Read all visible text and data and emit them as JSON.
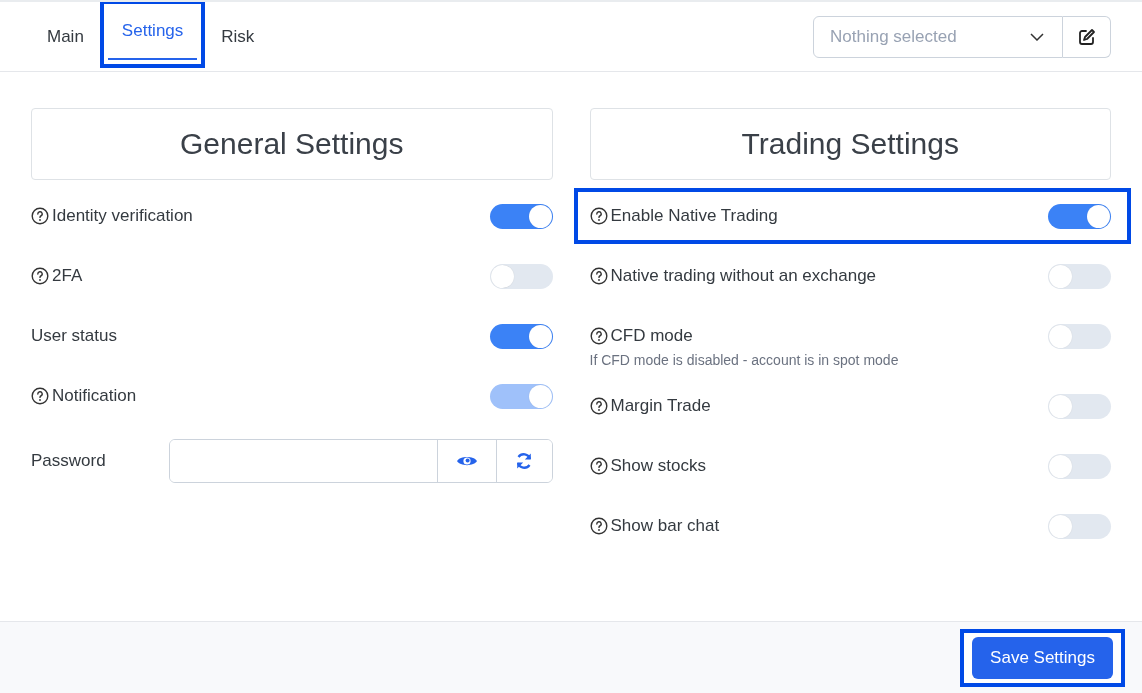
{
  "tabs": [
    {
      "label": "Main",
      "selected": false,
      "highlighted": false
    },
    {
      "label": "Settings",
      "selected": true,
      "highlighted": true
    },
    {
      "label": "Risk",
      "selected": false,
      "highlighted": false
    }
  ],
  "selector": {
    "placeholder": "Nothing selected"
  },
  "sections": [
    {
      "title": "General Settings",
      "items": [
        {
          "kind": "toggle",
          "label": "Identity verification",
          "help": true,
          "on": true,
          "disabled": false,
          "highlighted": false
        },
        {
          "kind": "toggle",
          "label": "2FA",
          "help": true,
          "on": false,
          "disabled": false,
          "highlighted": false
        },
        {
          "kind": "toggle",
          "label": "User status",
          "help": false,
          "on": true,
          "disabled": false,
          "highlighted": false
        },
        {
          "kind": "toggle",
          "label": "Notification",
          "help": true,
          "on": true,
          "disabled": true,
          "highlighted": false
        },
        {
          "kind": "password",
          "label": "Password"
        }
      ]
    },
    {
      "title": "Trading Settings",
      "items": [
        {
          "kind": "toggle",
          "label": "Enable Native Trading",
          "help": true,
          "on": true,
          "disabled": false,
          "highlighted": true
        },
        {
          "kind": "toggle",
          "label": "Native trading without an exchange",
          "help": true,
          "on": false,
          "disabled": false,
          "highlighted": false
        },
        {
          "kind": "toggle",
          "label": "CFD mode",
          "help": true,
          "on": false,
          "disabled": false,
          "highlighted": false
        },
        {
          "kind": "note",
          "text": "If CFD mode is disabled - account is in spot mode"
        },
        {
          "kind": "toggle",
          "label": "Margin Trade",
          "help": true,
          "on": false,
          "disabled": false,
          "highlighted": false
        },
        {
          "kind": "toggle",
          "label": "Show stocks",
          "help": true,
          "on": false,
          "disabled": false,
          "highlighted": false
        },
        {
          "kind": "toggle",
          "label": "Show bar chat",
          "help": true,
          "on": false,
          "disabled": false,
          "highlighted": false
        }
      ]
    }
  ],
  "save_button": {
    "label": "Save Settings",
    "highlighted": true
  }
}
